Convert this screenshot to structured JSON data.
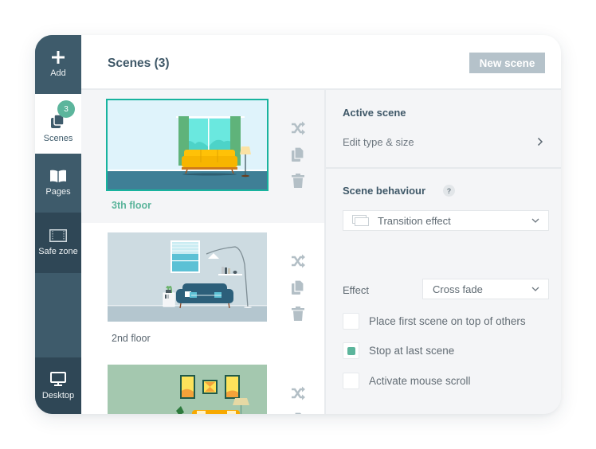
{
  "sidebar": {
    "items": [
      {
        "id": "add",
        "label": "Add",
        "icon": "plus-icon"
      },
      {
        "id": "scenes",
        "label": "Scenes",
        "icon": "layers-icon",
        "badge": "3",
        "active": true
      },
      {
        "id": "pages",
        "label": "Pages",
        "icon": "book-icon"
      },
      {
        "id": "safe-zone",
        "label": "Safe zone",
        "icon": "film-frame-icon"
      },
      {
        "id": "desktop",
        "label": "Desktop",
        "icon": "monitor-icon"
      }
    ]
  },
  "header": {
    "title": "Scenes (3)",
    "new_scene_label": "New scene"
  },
  "scenes": [
    {
      "name": "3th floor",
      "active": true,
      "thumbnail": "living-room-yellow-sofa"
    },
    {
      "name": "2nd floor",
      "active": false,
      "thumbnail": "living-room-blue-sofa"
    },
    {
      "name": "",
      "active": false,
      "thumbnail": "living-room-green-wall-frames"
    }
  ],
  "scene_actions": [
    "shuffle-icon",
    "duplicate-icon",
    "trash-icon"
  ],
  "panel": {
    "active_scene_title": "Active scene",
    "edit_type_label": "Edit type & size",
    "behaviour_title": "Scene behaviour",
    "help_label": "?",
    "transition_select": {
      "value": "Transition effect"
    },
    "effect": {
      "label": "Effect",
      "value": "Cross fade"
    },
    "checkboxes": [
      {
        "label": "Place first scene on top of others",
        "checked": false
      },
      {
        "label": "Stop at last scene",
        "checked": true
      },
      {
        "label": "Activate mouse scroll",
        "checked": false
      }
    ]
  },
  "colors": {
    "sidebar": "#3e5b6b",
    "sidebar_dark": "#2f4756",
    "accent": "#5cb59c",
    "active_border": "#18b39e",
    "button": "#b5c2ca"
  }
}
